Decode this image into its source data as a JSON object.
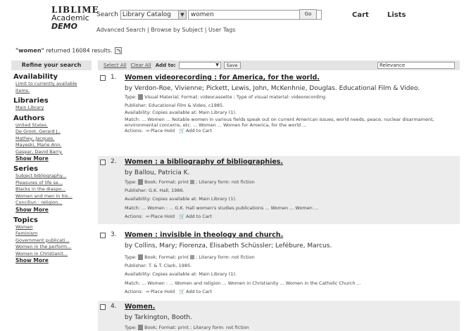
{
  "header": {
    "logo_line1": "LIBLIME",
    "logo_line2": "Academic",
    "logo_line3": "DEMO",
    "search_label": "Search",
    "catalog_value": "Library Catalog",
    "search_value": "women",
    "go_label": "Go",
    "cart_label": "Cart",
    "lists_label": "Lists",
    "subnav": "Advanced Search | Browse by Subject | User Tags"
  },
  "results_summary": {
    "query": "\"women\"",
    "text": " returned 16084 results."
  },
  "sidebar": {
    "refine_title": "Refine your search",
    "availability": {
      "title": "Availability",
      "items": [
        "Limit to currently available",
        "items."
      ]
    },
    "libraries": {
      "title": "Libraries",
      "items": [
        "Main Library"
      ]
    },
    "authors": {
      "title": "Authors",
      "items": [
        "United States.",
        "De Groot, Gerard J.,",
        "Mathey, Jacques.",
        "Mayeski, Marie Ann.",
        "Gaspar, David Barry."
      ],
      "show_more": "Show More"
    },
    "series": {
      "title": "Series",
      "items": [
        "Subject bibliography...",
        "Pleasures of life se...",
        "Blacks in the diaspo...",
        "Women and men in his...",
        "Conciliun : religion..."
      ],
      "show_more": "Show More"
    },
    "topics": {
      "title": "Topics",
      "items": [
        "Women",
        "Feminism",
        "Government publicati...",
        "Women in the perform...",
        "Women in Christianit..."
      ],
      "show_more": "Show More"
    }
  },
  "toolbar": {
    "select_all": "Select All",
    "clear_all": "Clear All",
    "add_to": "Add to:",
    "save": "Save",
    "sort": "Relevance"
  },
  "results": [
    {
      "num": "1.",
      "title": "Women videorecording : for America, for the world.",
      "author": "by Verdon-Roe, Vivienne; Pickett, Lewis, John, McKenhnie, Douglas. Educational Film & Video.",
      "type": "Type:",
      "type_text": "Visual Material; Format: videocassette ; Type of visual material: videorecording",
      "publisher": "Publisher: Educational Film & Video, c1985.",
      "availability": "Availability: Copies available at: Main Library (1).",
      "match": "Match: ... Women ... Notable women in various fields speak out on current American issues, world needs, peace, nuclear disarmament,",
      "match2": "environmental concerns, etc. ... Women ... Women for America, for the world ...",
      "actions": "Actions:",
      "hold": "Place Hold",
      "cart": "Add to Cart"
    },
    {
      "num": "2.",
      "title": "Women : a bibliography of bibliographies.",
      "author": "by Ballou, Patricia K.",
      "type": "Type:",
      "type_text": "Book; Format: print",
      "type_text2": "; Literary form: not fiction",
      "publisher": "Publisher: G.K. Hall, 1986.",
      "availability": "Availability: Copies available at: Main Library (1).",
      "match": "Match: ... Women : ... G.K. Hall women's studies publications ... Women ... Women ...",
      "actions": "Actions:",
      "hold": "Place Hold",
      "cart": "Add to Cart"
    },
    {
      "num": "3.",
      "title": "Women : invisible in theology and church.",
      "author": "by Collins, Mary; Fiorenza, Elisabeth Schüssler; Lefébure, Marcus.",
      "type": "Type:",
      "type_text": "Book; Format: print",
      "type_text2": "; Literary form: not fiction",
      "publisher": "Publisher: T. & T. Clark, 1985.",
      "availability": "Availability: Copies available at: Main Library (1).",
      "match": "Match: ... Women : ... Women and religion ... Women in Christianity ... Women in the Catholic Church ...",
      "actions": "Actions:",
      "hold": "Place Hold",
      "cart": "Add to Cart"
    },
    {
      "num": "4.",
      "title": "Women.",
      "author": "by Tarkington, Booth.",
      "type": "Type:",
      "type_text": "Book; Format: print ; Literary form: not fiction"
    }
  ]
}
